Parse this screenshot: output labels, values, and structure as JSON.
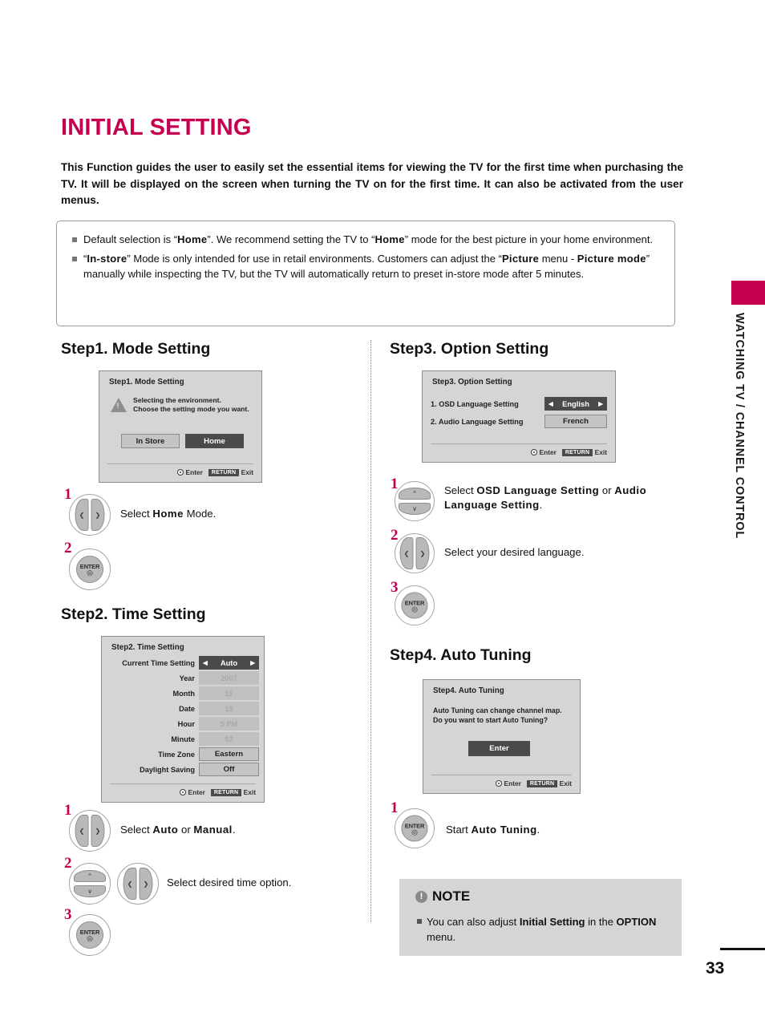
{
  "page": {
    "title": "INITIAL SETTING",
    "intro": "This Function guides the user to easily set the essential items for viewing the TV for the first time when purchasing the TV. It will be displayed on the screen when turning the TV on for the first time. It can also be activated from the user menus.",
    "number": "33",
    "side_tab_label": "WATCHING TV / CHANNEL CONTROL",
    "accent_color": "#C50050"
  },
  "info_box": {
    "bullet1": {
      "p1": "Default selection is “",
      "b1": "Home",
      "p2": "”. We recommend setting the TV to “",
      "b2": "Home",
      "p3": "” mode for the best picture in your home environment."
    },
    "bullet2": {
      "p1": "“",
      "b1": "In-store",
      "p2": "” Mode is only intended for use in retail environments. Customers can adjust the “",
      "b2": "Picture",
      "p3": " menu - ",
      "b3": "Picture mode",
      "p4": "” manually while inspecting the TV, but the TV will automatically return to preset in-store mode after 5 minutes."
    }
  },
  "step1": {
    "heading": "Step1. Mode Setting",
    "osd": {
      "title": "Step1. Mode Setting",
      "warning_icon": "warning-triangle",
      "message_line1": "Selecting the environment.",
      "message_line2": "Choose the setting mode you want.",
      "button_in_store": "In Store",
      "button_home": "Home",
      "footer_enter": "Enter",
      "footer_return_chip": "RETURN",
      "footer_exit": "Exit"
    },
    "actions": [
      {
        "num": "1",
        "button": "left-right-nav",
        "text_pre": "Select ",
        "text_bold": "Home",
        "text_post": " Mode."
      },
      {
        "num": "2",
        "button": "enter",
        "label": "ENTER",
        "text_pre": "",
        "text_bold": "",
        "text_post": ""
      }
    ]
  },
  "step2": {
    "heading": "Step2. Time Setting",
    "osd": {
      "title": "Step2. Time Setting",
      "rows": [
        {
          "label": "Current Time Setting",
          "value": "Auto",
          "state": "selected"
        },
        {
          "label": "Year",
          "value": "2007",
          "state": "dim"
        },
        {
          "label": "Month",
          "value": "11",
          "state": "dim"
        },
        {
          "label": "Date",
          "value": "15",
          "state": "dim"
        },
        {
          "label": "Hour",
          "value": "5 PM",
          "state": "dim"
        },
        {
          "label": "Minute",
          "value": "52",
          "state": "dim"
        },
        {
          "label": "Time Zone",
          "value": "Eastern",
          "state": "normal"
        },
        {
          "label": "Daylight Saving",
          "value": "Off",
          "state": "normal"
        }
      ],
      "footer_enter": "Enter",
      "footer_return_chip": "RETURN",
      "footer_exit": "Exit"
    },
    "actions": [
      {
        "num": "1",
        "button": "left-right-nav",
        "text_pre": "Select ",
        "text_bold": "Auto",
        "text_mid": " or ",
        "text_bold2": "Manual",
        "text_post": "."
      },
      {
        "num": "2",
        "button": "up-down-nav",
        "button2": "left-right-nav",
        "text_pre": "Select desired time option.",
        "text_bold": "",
        "text_post": ""
      },
      {
        "num": "3",
        "button": "enter",
        "label": "ENTER",
        "text_pre": "",
        "text_bold": "",
        "text_post": ""
      }
    ]
  },
  "step3": {
    "heading": "Step3. Option Setting",
    "osd": {
      "title": "Step3. Option Setting",
      "rows": [
        {
          "label": "1. OSD Language Setting",
          "value": "English",
          "state": "selected"
        },
        {
          "label": "2. Audio Language Setting",
          "value": "French",
          "state": "normal"
        }
      ],
      "footer_enter": "Enter",
      "footer_return_chip": "RETURN",
      "footer_exit": "Exit"
    },
    "actions": [
      {
        "num": "1",
        "button": "up-down-nav",
        "text_pre": "Select ",
        "text_bold": "OSD Language Setting",
        "text_mid": " or ",
        "text_bold2": "Audio Language Setting",
        "text_post": "."
      },
      {
        "num": "2",
        "button": "left-right-nav",
        "text_pre": "Select your desired language.",
        "text_bold": "",
        "text_post": ""
      },
      {
        "num": "3",
        "button": "enter",
        "label": "ENTER",
        "text_pre": "",
        "text_bold": "",
        "text_post": ""
      }
    ]
  },
  "step4": {
    "heading": "Step4. Auto Tuning",
    "osd": {
      "title": "Step4. Auto Tuning",
      "message_line1": "Auto Tuning can change channel map.",
      "message_line2": "Do you want to start Auto Tuning?",
      "button_enter": "Enter",
      "footer_enter": "Enter",
      "footer_return_chip": "RETURN",
      "footer_exit": "Exit"
    },
    "actions": [
      {
        "num": "1",
        "button": "enter",
        "label": "ENTER",
        "text_pre": "Start ",
        "text_bold": "Auto Tuning",
        "text_post": "."
      }
    ]
  },
  "note": {
    "heading": "NOTE",
    "icon": "exclamation-circle",
    "body_pre": "You can also adjust ",
    "body_bold": "Initial Setting",
    "body_mid": " in the ",
    "body_bold2": "OPTION",
    "body_post": " menu."
  }
}
